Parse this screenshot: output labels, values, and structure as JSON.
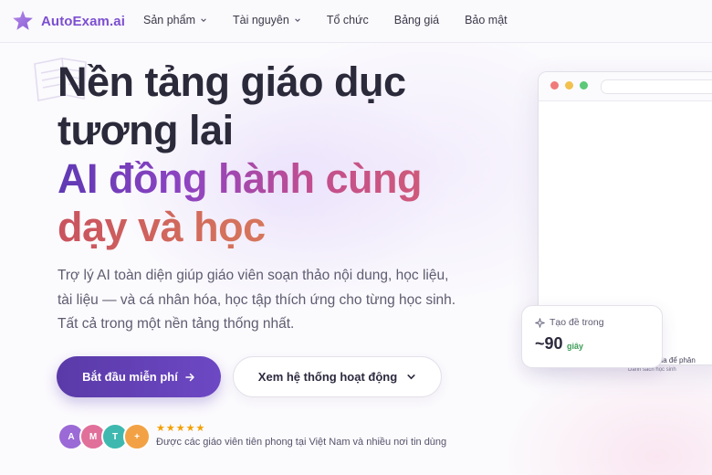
{
  "brand": {
    "name": "AutoExam.ai",
    "logo_icon": "sparkle-star-icon",
    "accent_color": "#7c4fd0"
  },
  "nav": {
    "items": [
      {
        "label": "Sản phẩm",
        "has_dropdown": true
      },
      {
        "label": "Tài nguyên",
        "has_dropdown": true
      },
      {
        "label": "Tổ chức",
        "has_dropdown": false
      },
      {
        "label": "Bảng giá",
        "has_dropdown": false
      },
      {
        "label": "Bảo mật",
        "has_dropdown": false
      }
    ]
  },
  "hero": {
    "title_line1": "Nền tảng giáo dục",
    "title_line2": "tương lai",
    "title_line3": "AI đồng hành cùng",
    "title_line4": "dạy và học",
    "subtitle": "Trợ lý AI toàn diện giúp giáo viên soạn thảo nội dung, học liệu, tài liệu — và cá nhân hóa, học tập thích ứng cho từng học sinh. Tất cả trong một nền tảng thống nhất."
  },
  "cta": {
    "primary_label": "Bắt đầu miễn phí",
    "primary_icon": "arrow-right-icon",
    "secondary_label": "Xem hệ thống hoạt động",
    "secondary_icon": "chevron-down-icon"
  },
  "social_proof": {
    "avatars": [
      {
        "initial": "A",
        "color": "#9b6ad6"
      },
      {
        "initial": "M",
        "color": "#e0709a"
      },
      {
        "initial": "T",
        "color": "#3fb9b0"
      },
      {
        "initial": "+",
        "color": "#f2a245"
      }
    ],
    "stars": "★★★★★",
    "star_color": "#f2a000",
    "rating": 5,
    "text": "Được các giáo viên tiên phong tại Việt Nam và nhiều nơi tin dùng"
  },
  "mockup": {
    "window_dots": [
      "#f07a7a",
      "#f2c14e",
      "#5cc878"
    ],
    "peek_text_1": "ạo tối đa để phân",
    "peek_text_2": "Danh sách học sinh"
  },
  "stat_card": {
    "icon": "sparkle-icon",
    "label": "Tạo đề trong",
    "value": "~90",
    "unit": "giây",
    "unit_color": "#3b9b55"
  }
}
